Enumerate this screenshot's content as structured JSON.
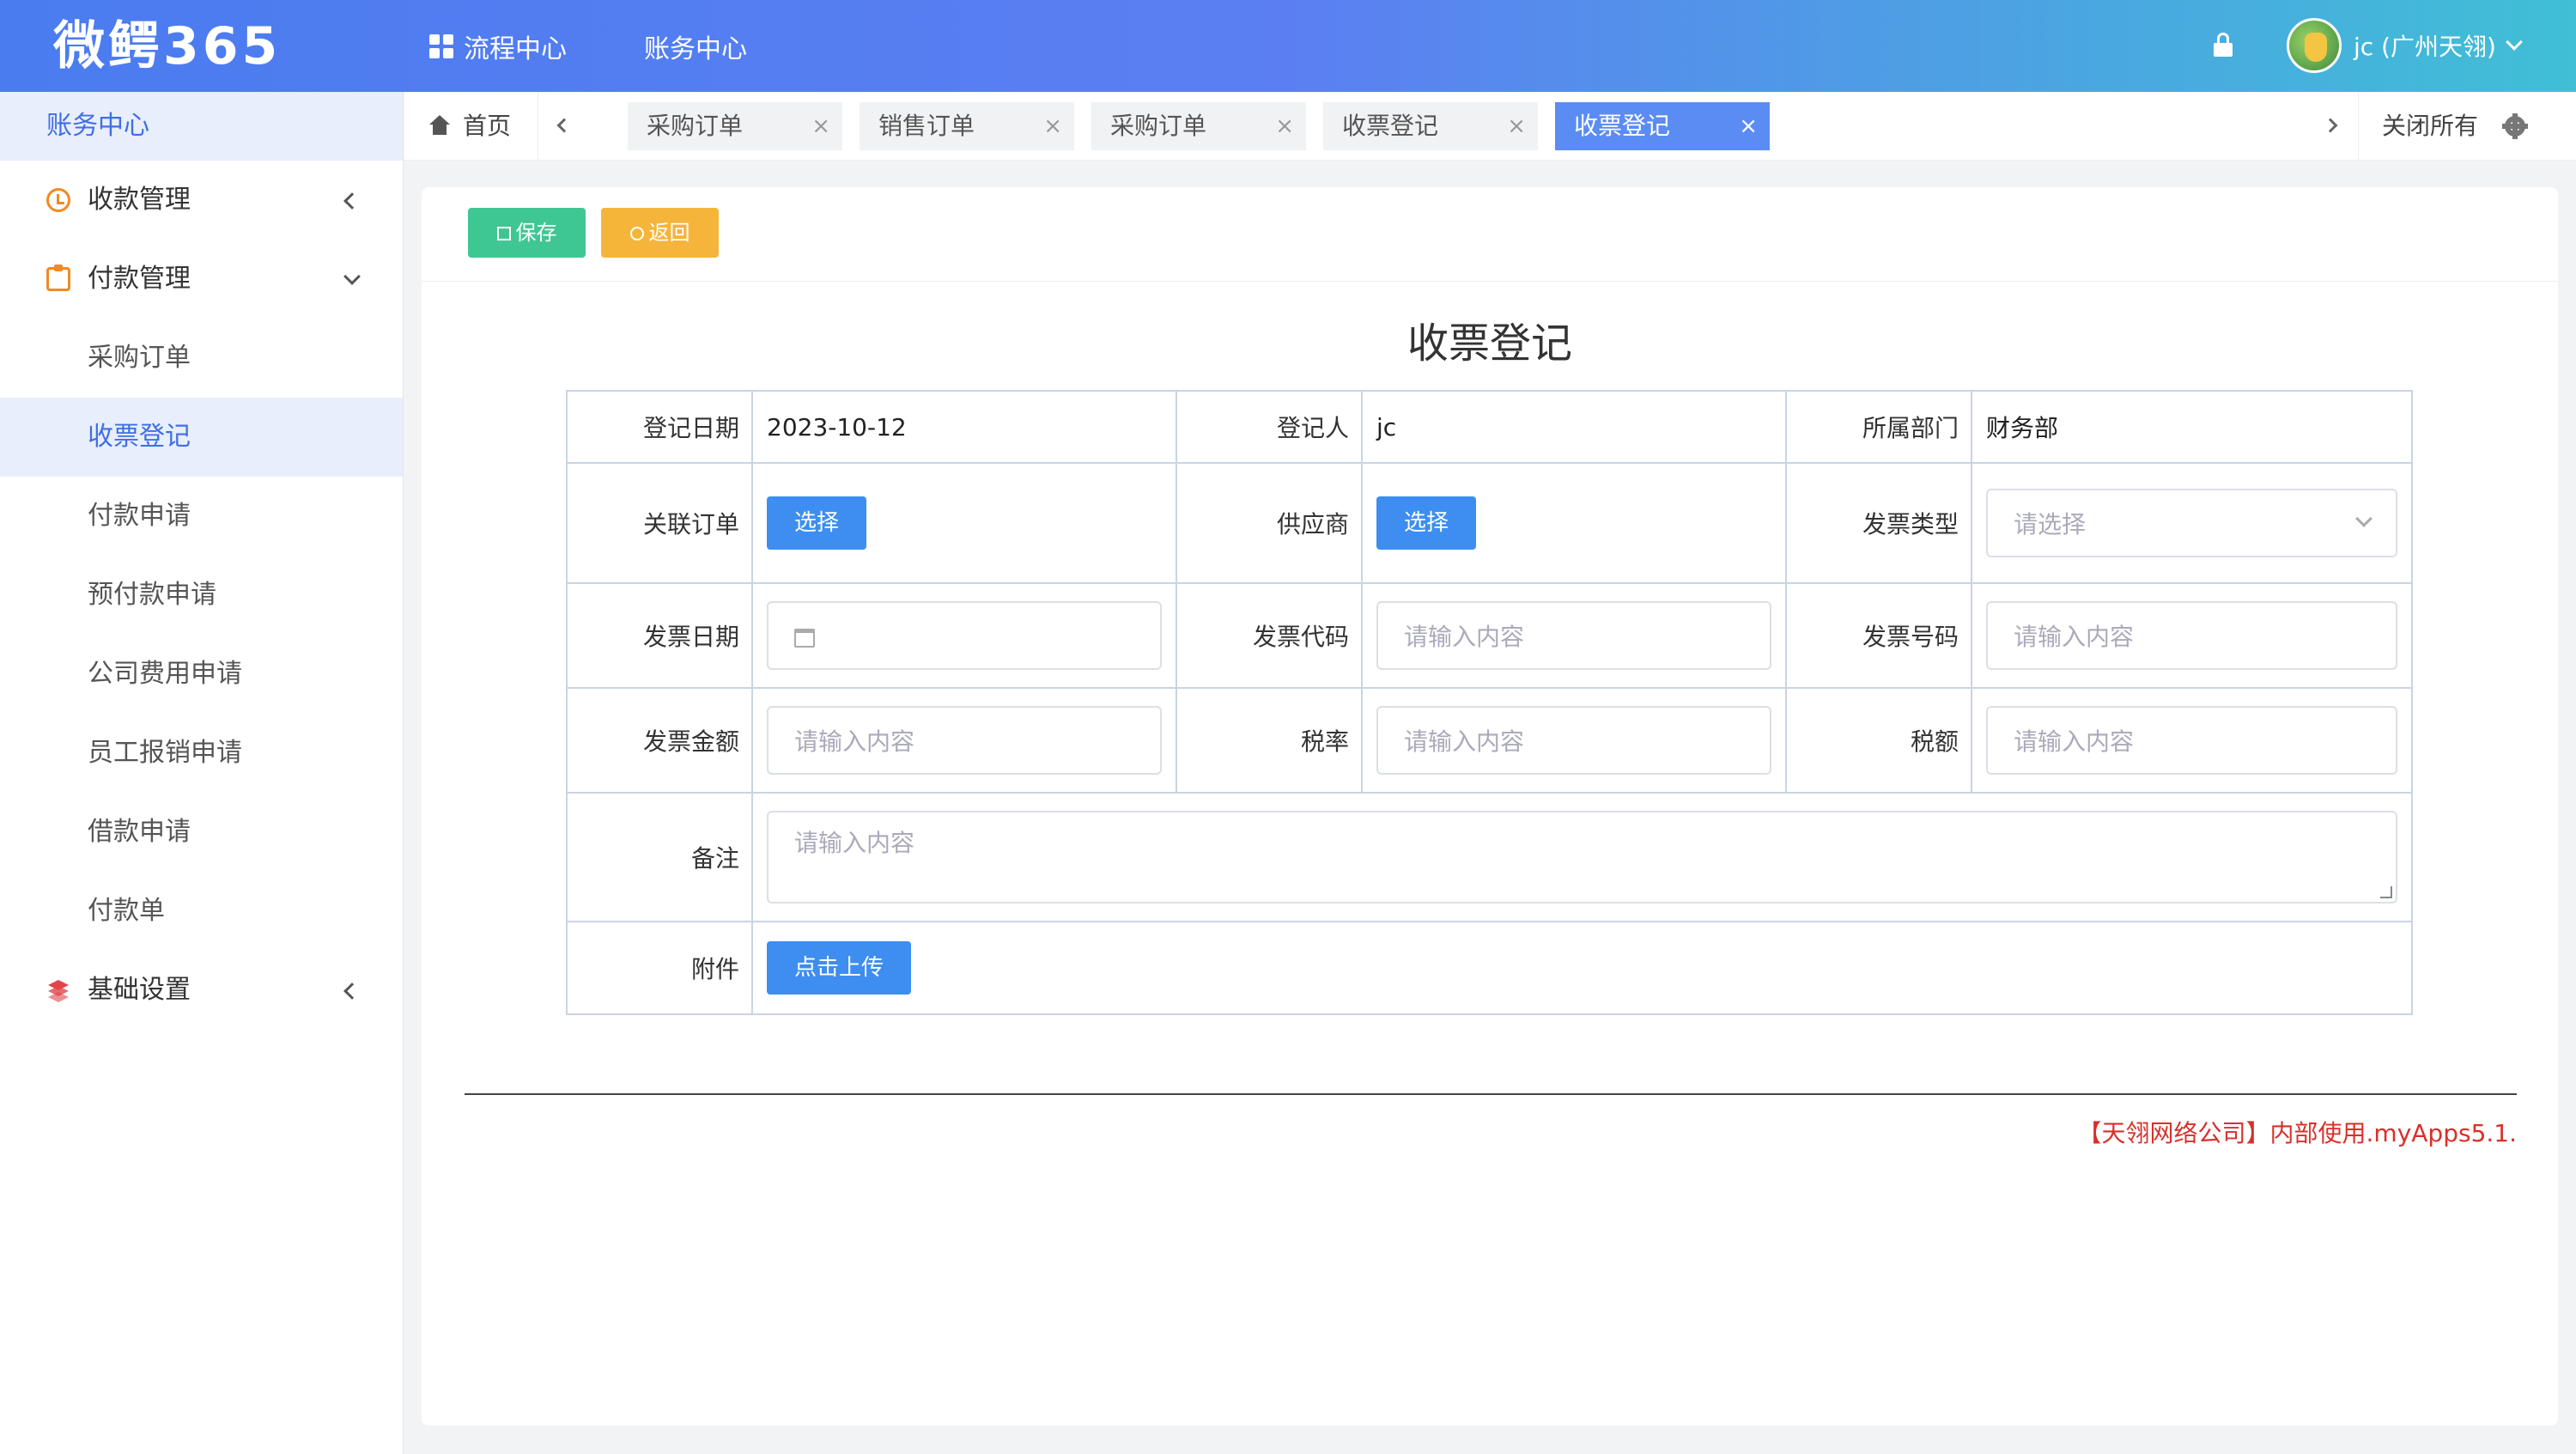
{
  "header": {
    "logo": "微鳄365",
    "nav": [
      "流程中心",
      "账务中心"
    ],
    "user": "jc (广州天翎)"
  },
  "sidebar": {
    "title": "账务中心",
    "items": [
      {
        "label": "收款管理",
        "type": "parent",
        "icon": "clock-icon",
        "state": "collapsed"
      },
      {
        "label": "付款管理",
        "type": "parent",
        "icon": "clipboard-icon",
        "state": "expanded"
      },
      {
        "label": "采购订单",
        "type": "sub"
      },
      {
        "label": "收票登记",
        "type": "sub",
        "active": true
      },
      {
        "label": "付款申请",
        "type": "sub"
      },
      {
        "label": "预付款申请",
        "type": "sub"
      },
      {
        "label": "公司费用申请",
        "type": "sub"
      },
      {
        "label": "员工报销申请",
        "type": "sub"
      },
      {
        "label": "借款申请",
        "type": "sub"
      },
      {
        "label": "付款单",
        "type": "sub"
      },
      {
        "label": "基础设置",
        "type": "parent",
        "icon": "layers-icon",
        "state": "collapsed"
      }
    ]
  },
  "tabs": {
    "home": "首页",
    "items": [
      "采购订单",
      "销售订单",
      "采购订单",
      "收票登记",
      "收票登记"
    ],
    "close_glyph": "×",
    "close_all": "关闭所有"
  },
  "toolbar": {
    "save": "保存",
    "back": "返回"
  },
  "form": {
    "title": "收票登记",
    "labels": {
      "date": "登记日期",
      "registrant": "登记人",
      "department": "所属部门",
      "order": "关联订单",
      "supplier": "供应商",
      "invoice_type": "发票类型",
      "invoice_date": "发票日期",
      "invoice_code": "发票代码",
      "invoice_number": "发票号码",
      "amount": "发票金额",
      "tax_rate": "税率",
      "tax": "税额",
      "remark": "备注",
      "attachment": "附件"
    },
    "values": {
      "date": "2023-10-12",
      "registrant": "jc",
      "department": "财务部"
    },
    "select_btn": "选择",
    "placeholder_input": "请输入内容",
    "placeholder_select": "请选择",
    "upload_btn": "点击上传"
  },
  "footer": {
    "copyright": "【天翎网络公司】内部使用.myApps5.1."
  }
}
